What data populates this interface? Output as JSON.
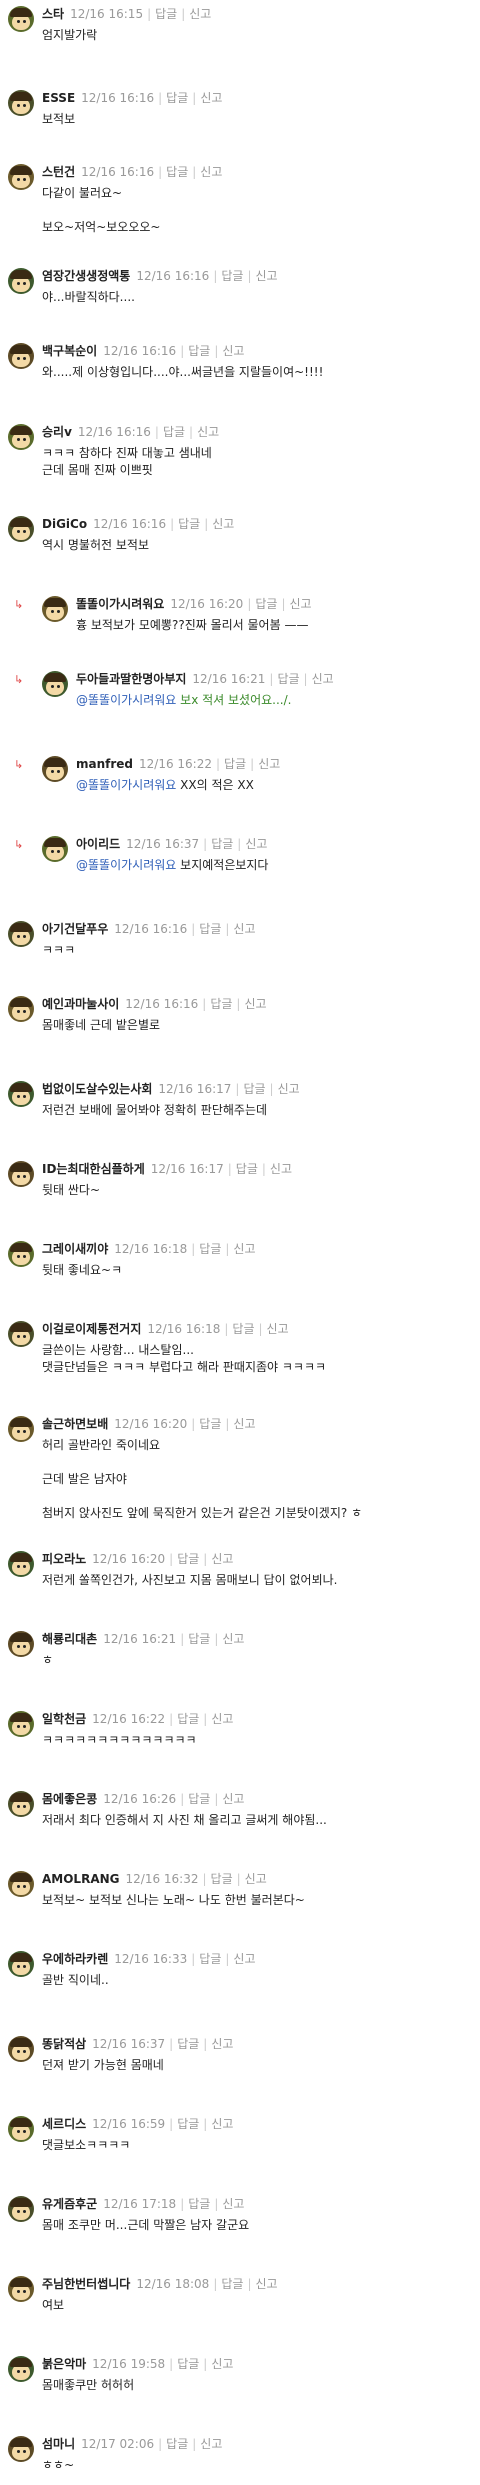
{
  "labels": {
    "reply": "답글",
    "report": "신고"
  },
  "comments": [
    {
      "nick": "스타",
      "time": "12/16 16:15",
      "lines": [
        "엄지발가락"
      ]
    },
    {
      "nick": "ESSE",
      "time": "12/16 16:16",
      "lines": [
        "보적보"
      ]
    },
    {
      "nick": "스턴건",
      "time": "12/16 16:16",
      "lines": [
        "다같이 불러요~",
        "",
        "보오~저억~보오오오~"
      ]
    },
    {
      "nick": "염장간생생정액통",
      "time": "12/16 16:16",
      "lines": [
        "야...바랄직하다...."
      ]
    },
    {
      "nick": "백구복순이",
      "time": "12/16 16:16",
      "lines": [
        "와.....제 이상형입니다....야...써글년을 지랄들이여~!!!!"
      ]
    },
    {
      "nick": "승리v",
      "time": "12/16 16:16",
      "lines": [
        "ㅋㅋㅋ 참하다 진짜 대놓고 샘내네",
        "근데 몸매 진짜 이쁘핏"
      ]
    },
    {
      "nick": "DiGiCo",
      "time": "12/16 16:16",
      "lines": [
        "역시 명불허전 보적보"
      ]
    },
    {
      "nick": "똘똘이가시려워요",
      "time": "12/16 16:20",
      "reply": true,
      "lines": [
        "흉 보적보가 모예뽕??진짜 몰리서 물어봄 ——"
      ]
    },
    {
      "nick": "두아들과딸한명아부지",
      "time": "12/16 16:21",
      "reply": true,
      "mention": "@똘똘이가시려워요",
      "mention_rest": "보x 적셔 보셨어요.../.",
      "rest_green": true
    },
    {
      "nick": "manfred",
      "time": "12/16 16:22",
      "reply": true,
      "mention": "@똘똘이가시려워요",
      "mention_rest": "XX의 적은 XX"
    },
    {
      "nick": "아이리드",
      "time": "12/16 16:37",
      "reply": true,
      "mention": "@똘똘이가시려워요",
      "mention_rest": "보지예적은보지다"
    },
    {
      "nick": "아기건달푸우",
      "time": "12/16 16:16",
      "lines": [
        "ㅋㅋㅋ"
      ]
    },
    {
      "nick": "예인과마눌사이",
      "time": "12/16 16:16",
      "lines": [
        "몸매좋네 근데 밭은별로"
      ]
    },
    {
      "nick": "법없이도살수있는사회",
      "time": "12/16 16:17",
      "lines": [
        "저런건 보배에 물어봐야 정확히 판단해주는데"
      ]
    },
    {
      "nick": "ID는최대한심플하게",
      "time": "12/16 16:17",
      "lines": [
        "뒷태 싼다~"
      ]
    },
    {
      "nick": "그레이새끼야",
      "time": "12/16 16:18",
      "lines": [
        "뒷태 좋네요~ㅋ"
      ]
    },
    {
      "nick": "이걸로이제통전거지",
      "time": "12/16 16:18",
      "lines": [
        "글쓴이는 사랑함... 내스탈임...",
        "댓글단넘들은 ㅋㅋㅋ 부럽다고 해라 판때지좀야 ㅋㅋㅋㅋ"
      ]
    },
    {
      "nick": "솔근하면보배",
      "time": "12/16 16:20",
      "lines": [
        "허리 골반라인 죽이네요",
        "",
        "근데 발은 남자야",
        "",
        "첨버지 앉사진도 앞에 묵직한거 있는거 같은건 기분탓이겠지? ㅎ"
      ]
    },
    {
      "nick": "피오라노",
      "time": "12/16 16:20",
      "lines": [
        "저런게 쏠쪽인건가, 사진보고 지몸 몸매보니 답이 없어뵈나."
      ]
    },
    {
      "nick": "해룡리대촌",
      "time": "12/16 16:21",
      "lines": [
        "ㅎ"
      ]
    },
    {
      "nick": "일학천금",
      "time": "12/16 16:22",
      "lines": [
        "ㅋㅋㅋㅋㅋㅋㅋㅋㅋㅋㅋㅋㅋㅋ"
      ]
    },
    {
      "nick": "몸에좋은콩",
      "time": "12/16 16:26",
      "lines": [
        "저래서 최다 인증해서 지 사진 채 올리고 글써게 해야됨..."
      ]
    },
    {
      "nick": "AMOLRANG",
      "time": "12/16 16:32",
      "lines": [
        "보적보~ 보적보 신나는 노래~ 나도 한번 불러본다~"
      ]
    },
    {
      "nick": "우에하라카렌",
      "time": "12/16 16:33",
      "lines": [
        "골반 직이네.."
      ]
    },
    {
      "nick": "똥닭적삼",
      "time": "12/16 16:37",
      "lines": [
        "던져 받기 가능현 몸매네"
      ]
    },
    {
      "nick": "세르디스",
      "time": "12/16 16:59",
      "lines": [
        "댓글보소ㅋㅋㅋㅋ"
      ]
    },
    {
      "nick": "유게즘후군",
      "time": "12/16 17:18",
      "lines": [
        "몸매 조쿠만 머...근데 막짤은 남자 갈군요"
      ]
    },
    {
      "nick": "주님한번터썹니다",
      "time": "12/16 18:08",
      "lines": [
        "여보"
      ]
    },
    {
      "nick": "붉은악마",
      "time": "12/16 19:58",
      "lines": [
        "몸매좋쿠만 허허허"
      ]
    },
    {
      "nick": "섬마니",
      "time": "12/17 02:06",
      "lines": [
        "ㅎㅎ~"
      ]
    }
  ]
}
